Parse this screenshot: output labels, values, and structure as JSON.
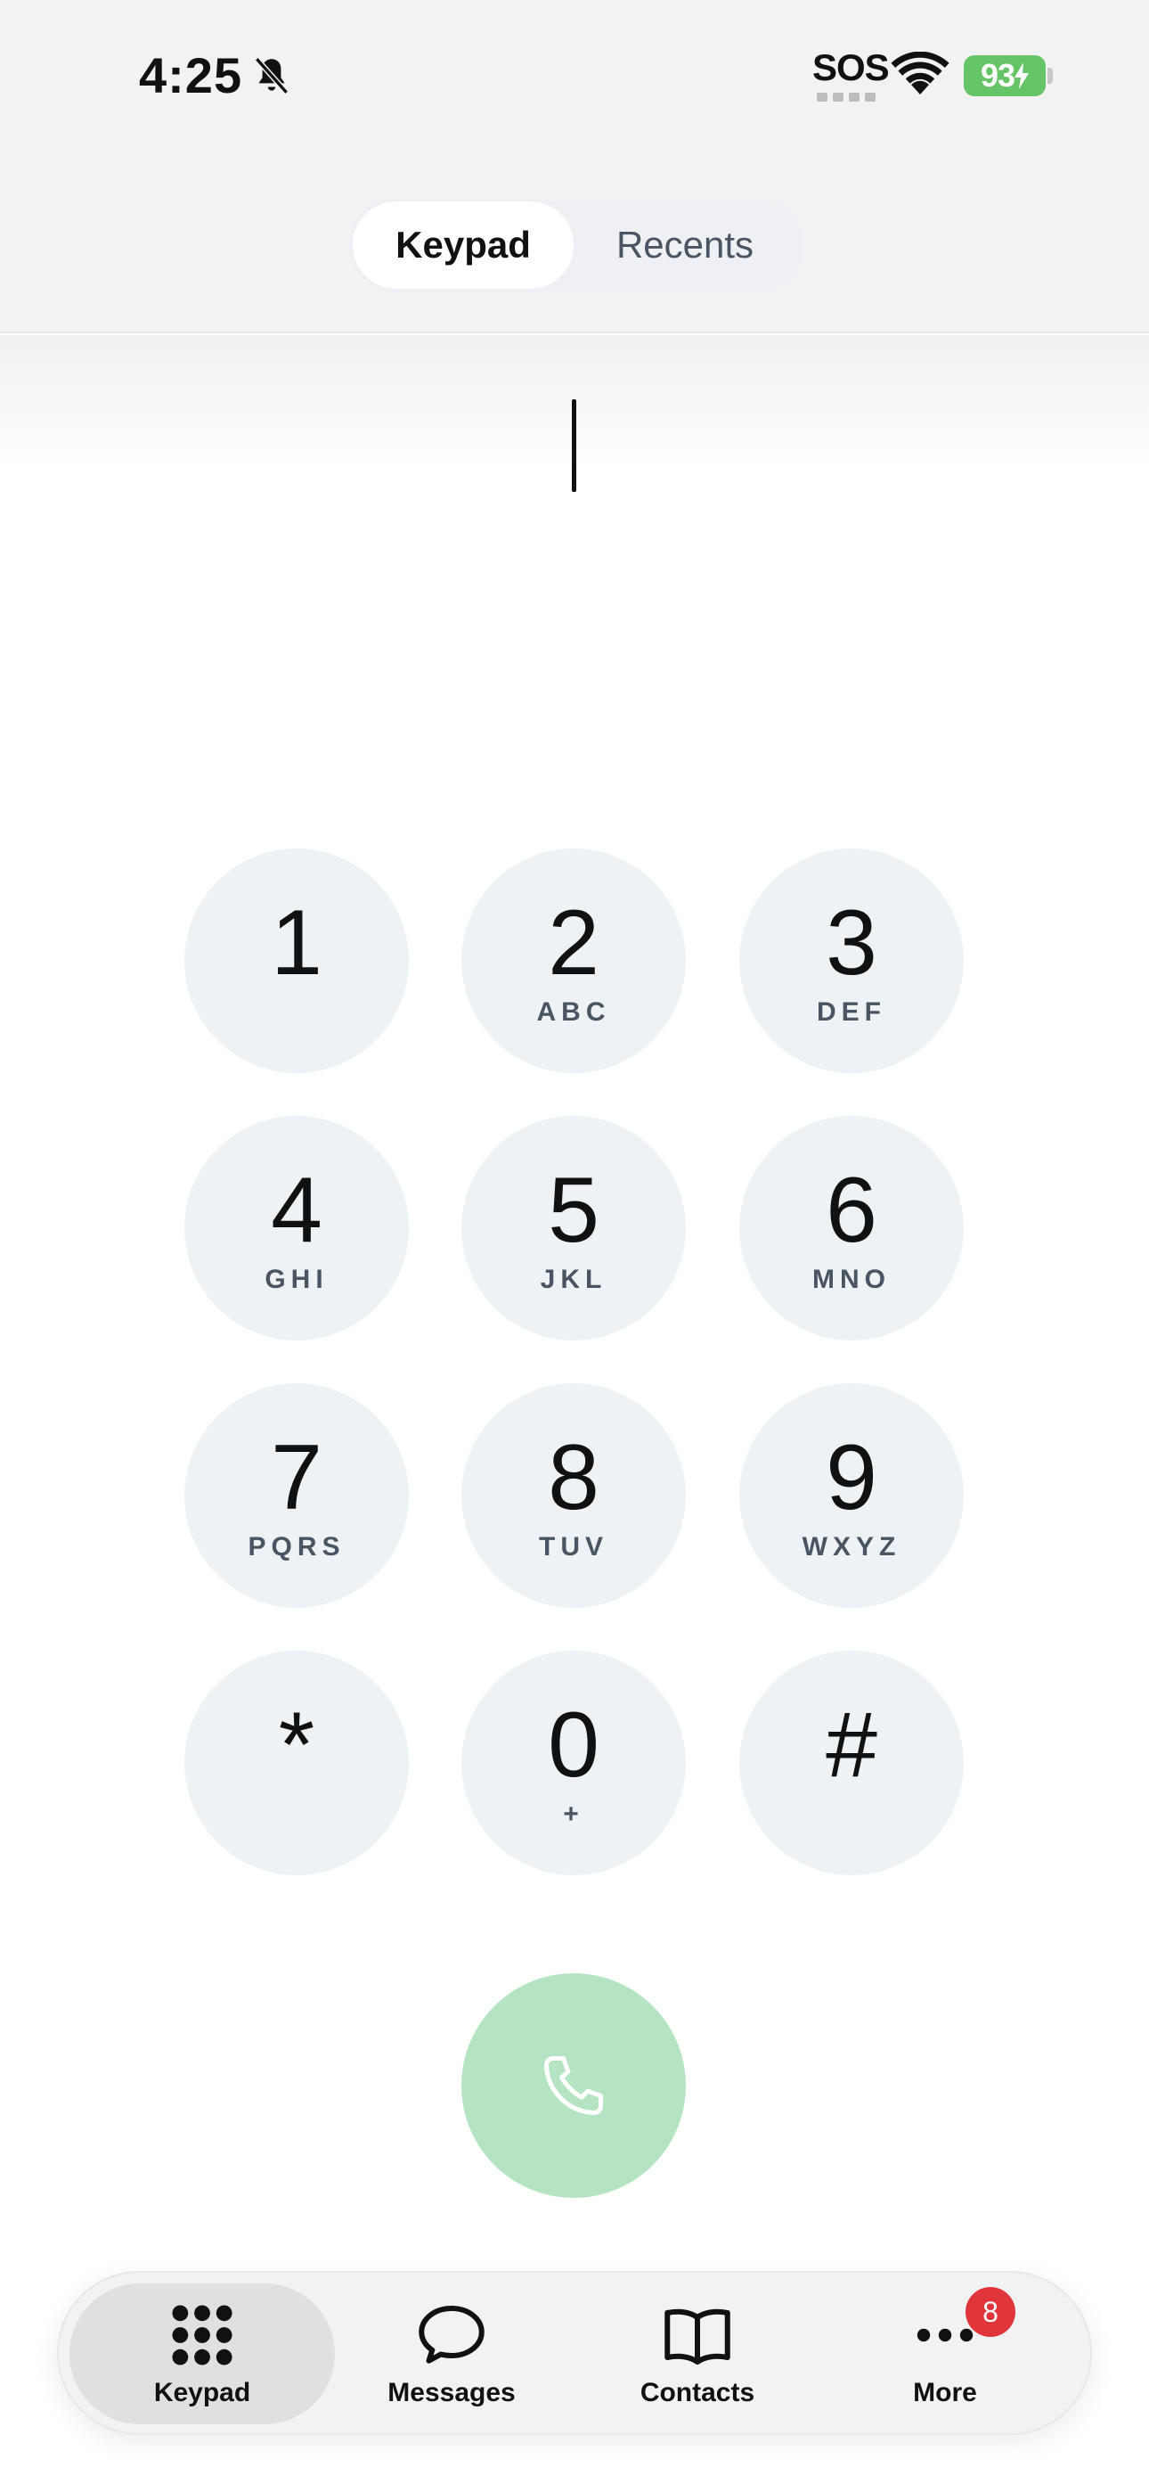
{
  "status_bar": {
    "time": "4:25",
    "sos_label": "SOS",
    "battery_level": "93",
    "icons": [
      "bell-slash-icon",
      "wifi-icon",
      "battery-charging-icon"
    ]
  },
  "segmented_control": {
    "tabs": [
      {
        "label": "Keypad",
        "selected": true
      },
      {
        "label": "Recents",
        "selected": false
      }
    ]
  },
  "dial_input": {
    "value": ""
  },
  "keypad": {
    "keys": [
      {
        "digit": "1",
        "letters": ""
      },
      {
        "digit": "2",
        "letters": "ABC"
      },
      {
        "digit": "3",
        "letters": "DEF"
      },
      {
        "digit": "4",
        "letters": "GHI"
      },
      {
        "digit": "5",
        "letters": "JKL"
      },
      {
        "digit": "6",
        "letters": "MNO"
      },
      {
        "digit": "7",
        "letters": "PQRS"
      },
      {
        "digit": "8",
        "letters": "TUV"
      },
      {
        "digit": "9",
        "letters": "WXYZ"
      },
      {
        "digit": "*",
        "letters": ""
      },
      {
        "digit": "0",
        "letters": "+"
      },
      {
        "digit": "#",
        "letters": ""
      }
    ]
  },
  "call_button": {
    "icon": "phone-icon",
    "color": "#b5e4c3"
  },
  "tab_bar": {
    "tabs": [
      {
        "label": "Keypad",
        "icon": "keypad-grid-icon",
        "selected": true
      },
      {
        "label": "Messages",
        "icon": "chat-bubble-icon",
        "selected": false
      },
      {
        "label": "Contacts",
        "icon": "book-icon",
        "selected": false
      },
      {
        "label": "More",
        "icon": "ellipsis-icon",
        "selected": false,
        "badge": "8"
      }
    ]
  },
  "colors": {
    "key_background": "#eff2f5",
    "call_green": "#b5e4c3",
    "badge_red": "#e0353a",
    "battery_green": "#65c466"
  }
}
